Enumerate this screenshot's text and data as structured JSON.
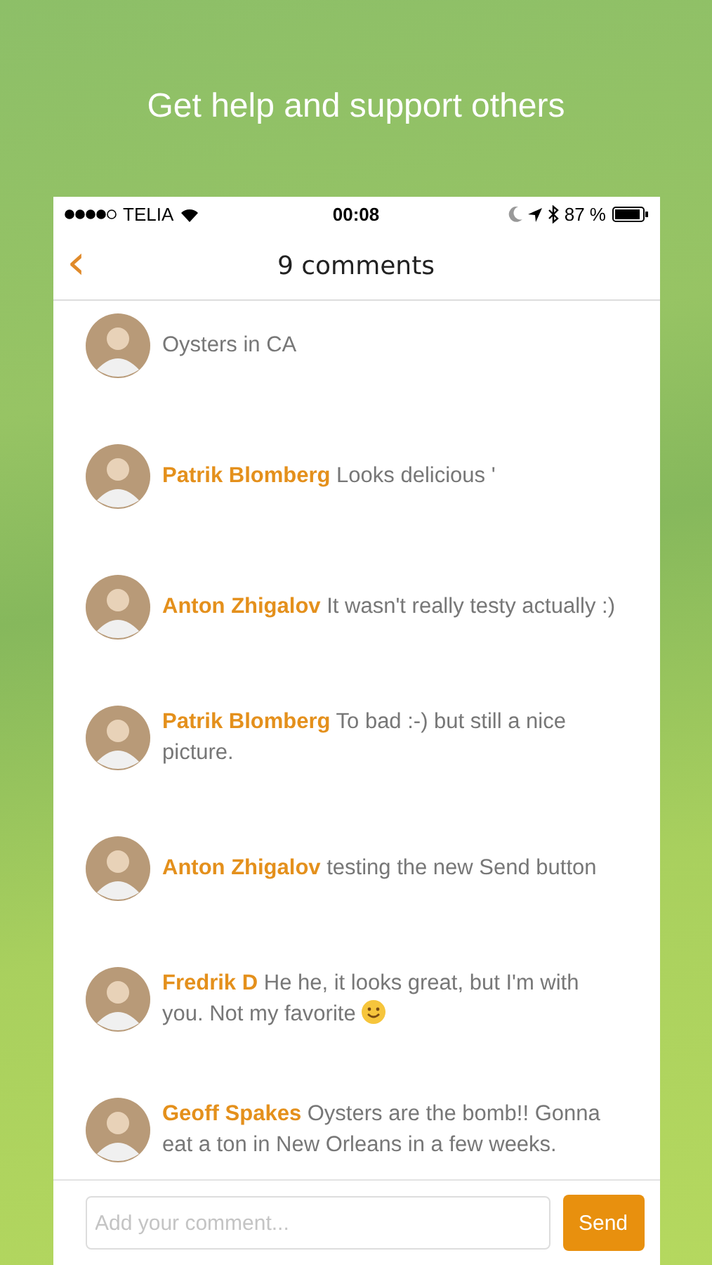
{
  "headline": "Get help and support others",
  "status_bar": {
    "carrier": "TELIA",
    "time": "00:08",
    "battery": "87 %"
  },
  "nav": {
    "back": "‹",
    "title": "9 comments"
  },
  "comments": [
    {
      "text": "Oysters in CA",
      "trailing_emoji": false
    },
    {
      "author": "Patrik Blomberg",
      "text": "Looks delicious '",
      "trailing_emoji": false
    },
    {
      "author": "Anton Zhigalov",
      "text": "It wasn't really testy actually :)",
      "trailing_emoji": false
    },
    {
      "author": "Patrik Blomberg",
      "text": "To bad :-) but still a nice picture.",
      "trailing_emoji": false
    },
    {
      "author": "Anton Zhigalov",
      "text": "testing the new Send button",
      "trailing_emoji": false
    },
    {
      "author": "Fredrik D",
      "text": "He he, it looks great, but I'm with you. Not my favorite",
      "trailing_emoji": true
    },
    {
      "author": "Geoff Spakes",
      "text": "Oysters are the bomb!! Gonna eat a ton in New Orleans in a few weeks.",
      "trailing_emoji": false
    }
  ],
  "composer": {
    "placeholder": "Add your comment...",
    "button": "Send"
  }
}
